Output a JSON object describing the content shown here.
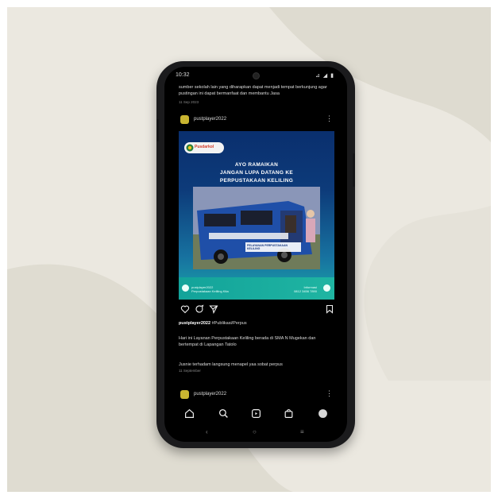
{
  "status_bar": {
    "time": "10:32",
    "icons": "⊿ ◢ ▮"
  },
  "previous_post": {
    "caption_line1": "sumber sekolah lain yang diharapkan dapat menjadi tempat berkunjung agar",
    "caption_line2": "pustingan ini dapat bermanfaat dan membantu Jasa",
    "time_ago": "11 Sep 2023"
  },
  "post": {
    "username": "pustplayer2022",
    "more_label": "⋮",
    "image": {
      "logo_text": "Pusdarkol",
      "headline_line1": "AYO RAMAIKAN",
      "headline_line2": "JANGAN LUPA DATANG KE",
      "headline_line3": "PERPUSTAKAAN KELILING",
      "banner_text": "PELAYANAN PERPUSTAKAAN KELILING",
      "footer_left_line1": "pustplayer2022",
      "footer_left_line2": "Perpustakaan Keliling Kita",
      "footer_right_line1": "Informasi",
      "footer_right_line2": "0812 3456 7890"
    },
    "likes_user": "pustplayer2022",
    "likes_tag": "#Publikasi/Perpus",
    "caption": "Hari ini Layanan Perpustakaan Keliling berada di SMA N Mugekan dan bertempat di Lapangan Tatolo",
    "caption2": "Jusnie terhadam langsung menapel yaa sobat perpus",
    "time_ago": "11 September"
  },
  "next_post": {
    "username": "pustplayer2022",
    "more_label": "⋮"
  },
  "system_nav": {
    "back": "‹",
    "home": "○",
    "recents": "≡"
  },
  "colors": {
    "screen_bg": "#000000",
    "card_bg": "#ebe8e0",
    "accent_teal": "#13a39a",
    "avatar": "#c9b531"
  }
}
